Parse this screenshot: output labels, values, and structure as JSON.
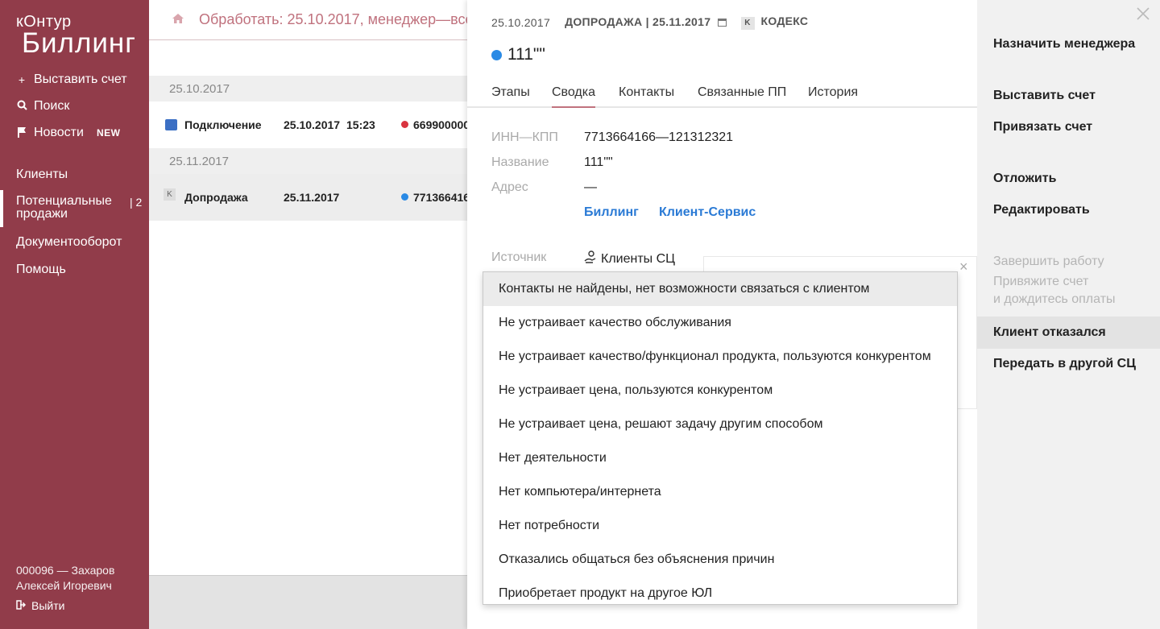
{
  "sidebar": {
    "logo_top": "кОнтур",
    "logo_main": "Биллинг",
    "actions": [
      {
        "label": "Выставить счет",
        "icon": "plus-icon"
      },
      {
        "label": "Поиск",
        "icon": "search-icon"
      },
      {
        "label": "Новости",
        "icon": "flag-icon",
        "badge": "NEW"
      }
    ],
    "nav": [
      {
        "label": "Клиенты"
      },
      {
        "label": "Потенциальные продажи",
        "count": "| 2"
      },
      {
        "label": "Документооборот"
      },
      {
        "label": "Помощь"
      }
    ],
    "user_line1": "000096 — Захаров",
    "user_line2": "Алексей Игоревич",
    "logout": "Выйти"
  },
  "list": {
    "header_title": "Обработать: 25.10.2017, менеджер—все",
    "groups": [
      {
        "date": "25.10.2017",
        "row": {
          "type": "Подключение",
          "date": "25.10.2017",
          "time": "15:23",
          "number": "669900000",
          "dot_color": "#d9343f"
        }
      },
      {
        "date": "25.11.2017",
        "row": {
          "type": "Допродажа",
          "date": "25.11.2017",
          "time": "",
          "number": "771366416",
          "dot_color": "#2a8ae5",
          "badge": "K"
        }
      }
    ]
  },
  "card": {
    "date": "25.10.2017",
    "kind": "ДОПРОДАЖА | 25.11.2017",
    "product_badge": "K",
    "product": "КОДЕКС",
    "title": "111\"\"",
    "title_dot_color": "#2a8ae5",
    "tabs": [
      "Этапы",
      "Сводка",
      "Контакты",
      "Связанные ПП",
      "История"
    ],
    "active_tab": "Сводка",
    "fields": {
      "inn_label": "ИНН—КПП",
      "inn_value": "7713664166—121312321",
      "name_label": "Название",
      "name_value": "111\"\"",
      "address_label": "Адрес",
      "address_value": "—",
      "link1": "Биллинг",
      "link2": "Клиент-Сервис",
      "source_label": "Источник",
      "source_value": "Клиенты СЦ"
    }
  },
  "dropdown": {
    "items": [
      "Контакты не найдены, нет возможности связаться с клиентом",
      "Не устраивает качество обслуживания",
      "Не устраивает качество/функционал продукта, пользуются конкурентом",
      "Не устраивает цена, пользуются конкурентом",
      "Не устраивает цена, решают задачу другим способом",
      "Нет деятельности",
      "Нет компьютера/интернета",
      "Нет потребности",
      "Отказались общаться без объяснения причин",
      "Приобретает продукт на другое ЮЛ"
    ],
    "hovered_index": 0
  },
  "actions": {
    "assign_manager": "Назначить менеджера",
    "issue_invoice": "Выставить счет",
    "link_invoice": "Привязать счет",
    "postpone": "Отложить",
    "edit": "Редактировать",
    "finish": "Завершить работу",
    "finish_hint_1": "Привяжите счет",
    "finish_hint_2": "и дождитесь оплаты",
    "client_refused": "Клиент отказался",
    "transfer": "Передать в другой СЦ"
  },
  "colors": {
    "sidebar_bg": "#913c4a",
    "accent": "#c0727e",
    "link": "#2a7ad5",
    "dot_red": "#d9343f",
    "dot_blue": "#2a8ae5"
  }
}
